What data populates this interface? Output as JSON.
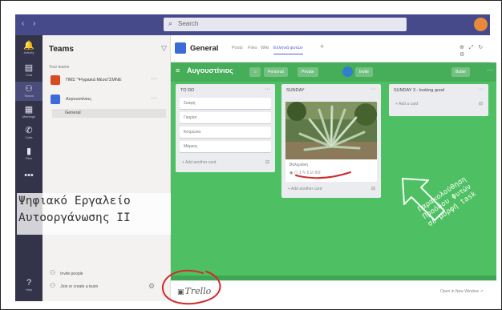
{
  "search": {
    "placeholder": "Search"
  },
  "rail": [
    {
      "icon": "bell-icon",
      "glyph": "🔔",
      "label": "Activity"
    },
    {
      "icon": "chat-icon",
      "glyph": "▤",
      "label": "Chat"
    },
    {
      "icon": "teams-icon",
      "glyph": "⚇",
      "label": "Teams"
    },
    {
      "icon": "calendar-icon",
      "glyph": "▦",
      "label": "Meetings"
    },
    {
      "icon": "calls-icon",
      "glyph": "✆",
      "label": "Calls"
    },
    {
      "icon": "files-icon",
      "glyph": "▮",
      "label": "Files"
    },
    {
      "icon": "more-icon",
      "glyph": "•••",
      "label": ""
    },
    {
      "icon": "help-icon",
      "glyph": "?",
      "label": "Help"
    }
  ],
  "teams_panel": {
    "title": "Teams",
    "your_teams": "Your teams",
    "team1": {
      "name": "ΠΜΣ \"Ψηφιακά Μέσα\"ΣΜΝΕ",
      "more": "···",
      "color": "#d94a1e"
    },
    "team2": {
      "name": "Αυγουστίνιος",
      "more": "···",
      "color": "#3b6bd8"
    },
    "channel": "General",
    "invite": "Invite people",
    "join": "Join or create a team"
  },
  "overlay_caption": {
    "line1": "Ψηφιακό Εργαλείο",
    "line2": "Αυτοοργάνωσης ΙΙ"
  },
  "channel_header": {
    "title": "General",
    "tabs": [
      "Posts",
      "Files",
      "Wiki",
      "Ελληνιά φυτών"
    ],
    "add": "+"
  },
  "board": {
    "name": "Αυγουστίνιος",
    "personal": "Personal",
    "private": "Private",
    "invite": "Invite",
    "butler": "Butler",
    "lists": [
      {
        "title": "TO DO",
        "cards": [
          "Σκάφη",
          "Γκαρίσι",
          "Κοτρώνια",
          "Μάρκος"
        ],
        "add": "+ Add another card"
      },
      {
        "title": "SUNDAY",
        "card_name": "Βαλεριάνη",
        "badges": "◉  ▢ 1  ✎ 0  ☑ 0/2",
        "add": "+ Add another card"
      },
      {
        "title": "SUNDAY 3 - looking good",
        "add": "+ Add a card"
      }
    ]
  },
  "trello_footer": {
    "logo": "Trello",
    "open": "Open in New Window ↗"
  },
  "annotation": {
    "line1": "Παρακολούθηση",
    "line2": "Προόδου Φυτών",
    "line3": "σε μορφή task"
  },
  "colors": {
    "board_green": "#4fbf63",
    "teams_purple": "#474a8a",
    "annotation_red": "#d32a2a"
  }
}
